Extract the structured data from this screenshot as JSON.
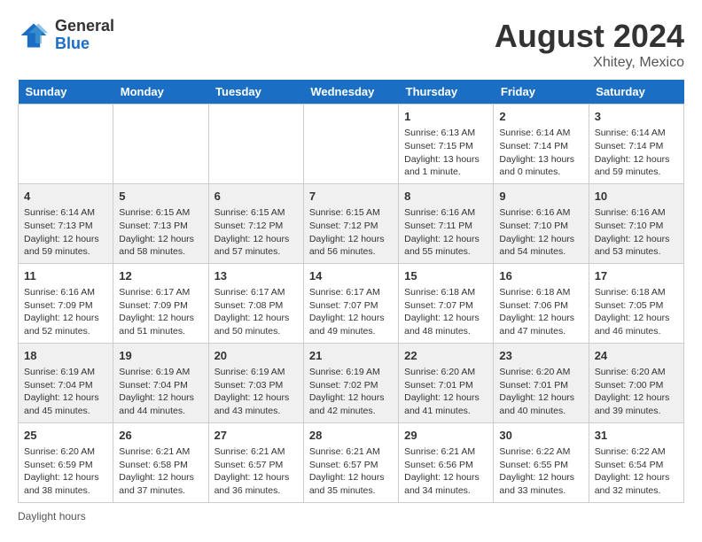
{
  "header": {
    "logo_line1": "General",
    "logo_line2": "Blue",
    "month_year": "August 2024",
    "location": "Xhitey, Mexico"
  },
  "footer": {
    "daylight_label": "Daylight hours"
  },
  "days_of_week": [
    "Sunday",
    "Monday",
    "Tuesday",
    "Wednesday",
    "Thursday",
    "Friday",
    "Saturday"
  ],
  "weeks": [
    [
      {
        "day": "",
        "info": ""
      },
      {
        "day": "",
        "info": ""
      },
      {
        "day": "",
        "info": ""
      },
      {
        "day": "",
        "info": ""
      },
      {
        "day": "1",
        "info": "Sunrise: 6:13 AM\nSunset: 7:15 PM\nDaylight: 13 hours\nand 1 minute."
      },
      {
        "day": "2",
        "info": "Sunrise: 6:14 AM\nSunset: 7:14 PM\nDaylight: 13 hours\nand 0 minutes."
      },
      {
        "day": "3",
        "info": "Sunrise: 6:14 AM\nSunset: 7:14 PM\nDaylight: 12 hours\nand 59 minutes."
      }
    ],
    [
      {
        "day": "4",
        "info": "Sunrise: 6:14 AM\nSunset: 7:13 PM\nDaylight: 12 hours\nand 59 minutes."
      },
      {
        "day": "5",
        "info": "Sunrise: 6:15 AM\nSunset: 7:13 PM\nDaylight: 12 hours\nand 58 minutes."
      },
      {
        "day": "6",
        "info": "Sunrise: 6:15 AM\nSunset: 7:12 PM\nDaylight: 12 hours\nand 57 minutes."
      },
      {
        "day": "7",
        "info": "Sunrise: 6:15 AM\nSunset: 7:12 PM\nDaylight: 12 hours\nand 56 minutes."
      },
      {
        "day": "8",
        "info": "Sunrise: 6:16 AM\nSunset: 7:11 PM\nDaylight: 12 hours\nand 55 minutes."
      },
      {
        "day": "9",
        "info": "Sunrise: 6:16 AM\nSunset: 7:10 PM\nDaylight: 12 hours\nand 54 minutes."
      },
      {
        "day": "10",
        "info": "Sunrise: 6:16 AM\nSunset: 7:10 PM\nDaylight: 12 hours\nand 53 minutes."
      }
    ],
    [
      {
        "day": "11",
        "info": "Sunrise: 6:16 AM\nSunset: 7:09 PM\nDaylight: 12 hours\nand 52 minutes."
      },
      {
        "day": "12",
        "info": "Sunrise: 6:17 AM\nSunset: 7:09 PM\nDaylight: 12 hours\nand 51 minutes."
      },
      {
        "day": "13",
        "info": "Sunrise: 6:17 AM\nSunset: 7:08 PM\nDaylight: 12 hours\nand 50 minutes."
      },
      {
        "day": "14",
        "info": "Sunrise: 6:17 AM\nSunset: 7:07 PM\nDaylight: 12 hours\nand 49 minutes."
      },
      {
        "day": "15",
        "info": "Sunrise: 6:18 AM\nSunset: 7:07 PM\nDaylight: 12 hours\nand 48 minutes."
      },
      {
        "day": "16",
        "info": "Sunrise: 6:18 AM\nSunset: 7:06 PM\nDaylight: 12 hours\nand 47 minutes."
      },
      {
        "day": "17",
        "info": "Sunrise: 6:18 AM\nSunset: 7:05 PM\nDaylight: 12 hours\nand 46 minutes."
      }
    ],
    [
      {
        "day": "18",
        "info": "Sunrise: 6:19 AM\nSunset: 7:04 PM\nDaylight: 12 hours\nand 45 minutes."
      },
      {
        "day": "19",
        "info": "Sunrise: 6:19 AM\nSunset: 7:04 PM\nDaylight: 12 hours\nand 44 minutes."
      },
      {
        "day": "20",
        "info": "Sunrise: 6:19 AM\nSunset: 7:03 PM\nDaylight: 12 hours\nand 43 minutes."
      },
      {
        "day": "21",
        "info": "Sunrise: 6:19 AM\nSunset: 7:02 PM\nDaylight: 12 hours\nand 42 minutes."
      },
      {
        "day": "22",
        "info": "Sunrise: 6:20 AM\nSunset: 7:01 PM\nDaylight: 12 hours\nand 41 minutes."
      },
      {
        "day": "23",
        "info": "Sunrise: 6:20 AM\nSunset: 7:01 PM\nDaylight: 12 hours\nand 40 minutes."
      },
      {
        "day": "24",
        "info": "Sunrise: 6:20 AM\nSunset: 7:00 PM\nDaylight: 12 hours\nand 39 minutes."
      }
    ],
    [
      {
        "day": "25",
        "info": "Sunrise: 6:20 AM\nSunset: 6:59 PM\nDaylight: 12 hours\nand 38 minutes."
      },
      {
        "day": "26",
        "info": "Sunrise: 6:21 AM\nSunset: 6:58 PM\nDaylight: 12 hours\nand 37 minutes."
      },
      {
        "day": "27",
        "info": "Sunrise: 6:21 AM\nSunset: 6:57 PM\nDaylight: 12 hours\nand 36 minutes."
      },
      {
        "day": "28",
        "info": "Sunrise: 6:21 AM\nSunset: 6:57 PM\nDaylight: 12 hours\nand 35 minutes."
      },
      {
        "day": "29",
        "info": "Sunrise: 6:21 AM\nSunset: 6:56 PM\nDaylight: 12 hours\nand 34 minutes."
      },
      {
        "day": "30",
        "info": "Sunrise: 6:22 AM\nSunset: 6:55 PM\nDaylight: 12 hours\nand 33 minutes."
      },
      {
        "day": "31",
        "info": "Sunrise: 6:22 AM\nSunset: 6:54 PM\nDaylight: 12 hours\nand 32 minutes."
      }
    ]
  ]
}
